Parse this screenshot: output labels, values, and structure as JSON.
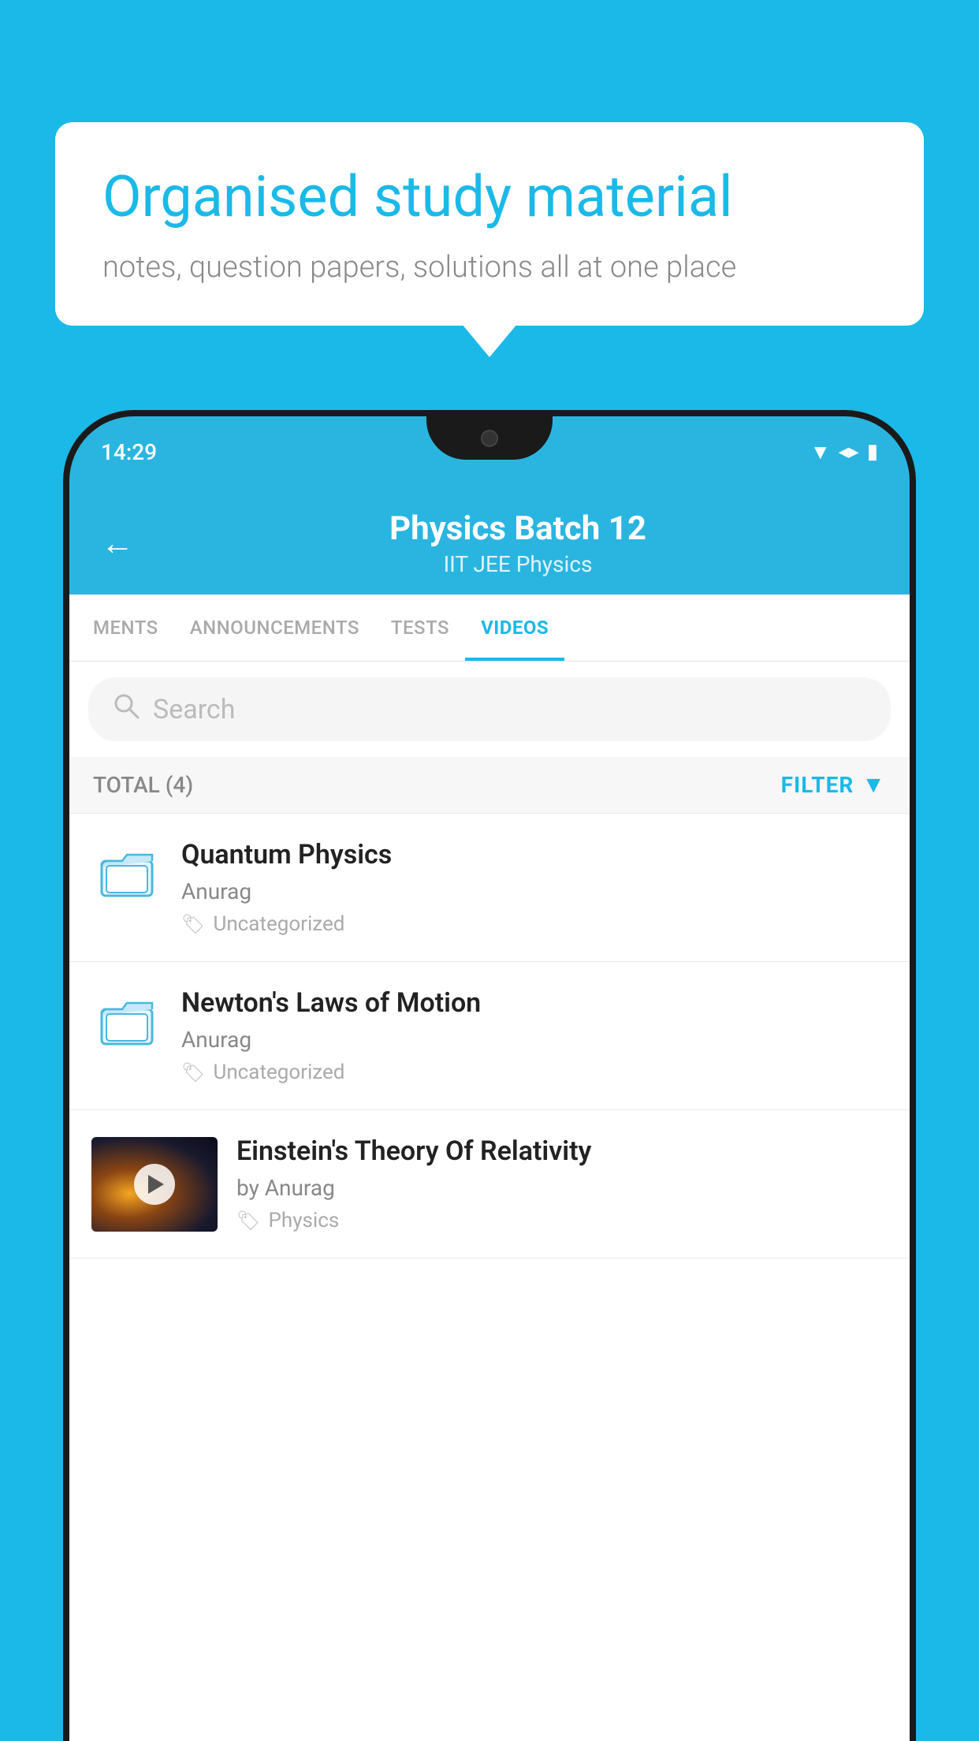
{
  "background": {
    "color": "#1ab9e8"
  },
  "speech_bubble": {
    "title": "Organised study material",
    "subtitle": "notes, question papers, solutions all at one place"
  },
  "phone": {
    "status_bar": {
      "time": "14:29"
    },
    "header": {
      "title": "Physics Batch 12",
      "subtitle": "IIT JEE   Physics",
      "back_label": "←"
    },
    "tabs": [
      {
        "label": "MENTS",
        "active": false
      },
      {
        "label": "ANNOUNCEMENTS",
        "active": false
      },
      {
        "label": "TESTS",
        "active": false
      },
      {
        "label": "VIDEOS",
        "active": true
      }
    ],
    "search": {
      "placeholder": "Search"
    },
    "filter_row": {
      "total_label": "TOTAL (4)",
      "filter_label": "FILTER"
    },
    "video_items": [
      {
        "id": 1,
        "title": "Quantum Physics",
        "author": "Anurag",
        "tag": "Uncategorized",
        "has_thumbnail": false
      },
      {
        "id": 2,
        "title": "Newton's Laws of Motion",
        "author": "Anurag",
        "tag": "Uncategorized",
        "has_thumbnail": false
      },
      {
        "id": 3,
        "title": "Einstein's Theory Of Relativity",
        "author": "by Anurag",
        "tag": "Physics",
        "has_thumbnail": true
      }
    ]
  }
}
